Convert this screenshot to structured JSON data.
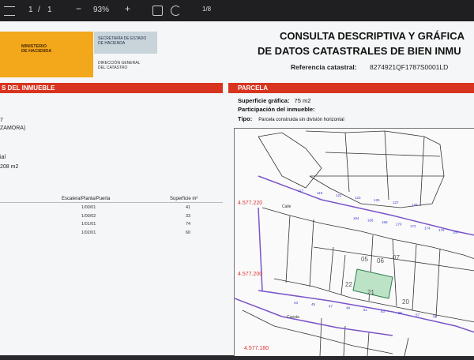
{
  "viewer": {
    "page_current": "1",
    "page_sep": "/",
    "page_total": "1",
    "zoom_minus": "−",
    "zoom": "93%",
    "zoom_plus": "+",
    "rotate_label": "1/8"
  },
  "header": {
    "ministry": "MINISTERIO\nDE HACIENDA",
    "secretaria": "SECRETARÍA DE ESTADO\nDE HACIENDA",
    "direccion": "DIRECCIÓN GENERAL\nDEL CATASTRO",
    "title_line1": "CONSULTA DESCRIPTIVA Y GRÁFICA",
    "title_line2": "DE DATOS CATASTRALES DE BIEN INMU",
    "ref_label": "Referencia catastral:",
    "ref_value": "8274921QF1787S0001LD"
  },
  "left": {
    "section_title": "S DEL INMUEBLE",
    "line_a": "7",
    "line_b": "ZAMORA)",
    "line_c": "ial",
    "line_d": "208 m2",
    "col_escalera": "Escalera/Planta/Puerta",
    "col_superficie": "Superficie m²",
    "rows": [
      {
        "ref": "1/00/01",
        "sup": "41"
      },
      {
        "ref": "1/00/02",
        "sup": "33"
      },
      {
        "ref": "1/01/01",
        "sup": "74"
      },
      {
        "ref": "1/02/01",
        "sup": "60"
      }
    ]
  },
  "parcela": {
    "section_title": "PARCELA",
    "sup_label": "Superficie gráfica:",
    "sup_value": "75 m2",
    "part_label": "Participación del inmueble:",
    "tipo_label": "Tipo:",
    "tipo_value": "Parcela construida sin división horizontal"
  },
  "map": {
    "coord_1": "4.577.220",
    "coord_2": "4.577.200",
    "coord_3": "4.577.180",
    "street_1": "Calle",
    "street_2": "Cuesta",
    "lot_labels": [
      "05",
      "06",
      "07",
      "22",
      "21",
      "20"
    ],
    "small_numbers": [
      "117",
      "119",
      "121",
      "123",
      "125",
      "127",
      "129",
      "164",
      "166",
      "168",
      "170",
      "172",
      "174",
      "176",
      "180",
      "43",
      "45",
      "47",
      "49",
      "51",
      "53",
      "55",
      "57",
      "59"
    ],
    "highlight_color": "#bde3c7",
    "boundary_color": "#7a54c9"
  }
}
